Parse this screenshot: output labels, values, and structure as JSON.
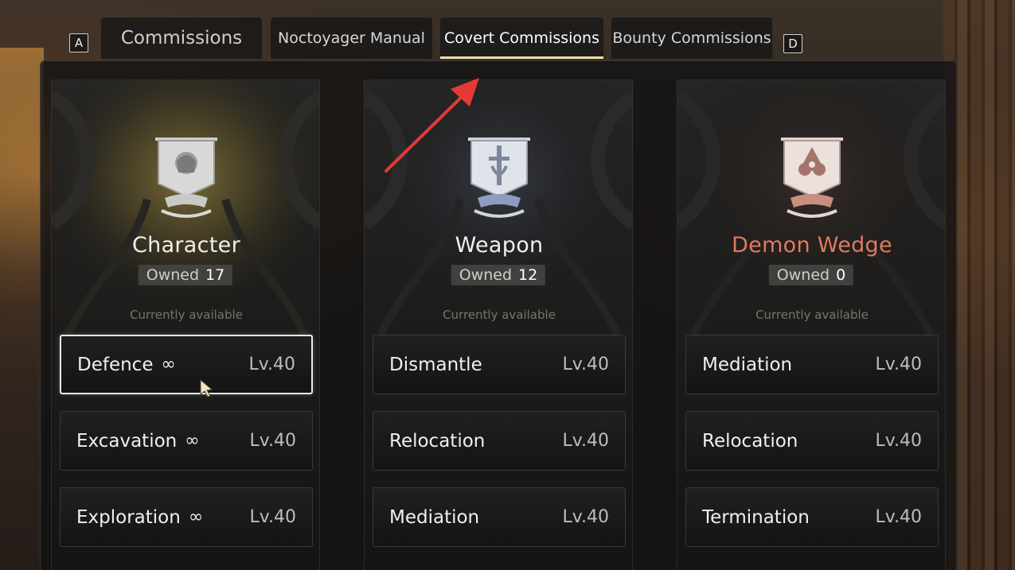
{
  "tabs": {
    "key_left": "A",
    "key_right": "D",
    "commissions": "Commissions",
    "manual": "Noctoyager Manual",
    "covert": "Covert Commissions",
    "bounty": "Bounty Commissions",
    "active": "Covert Commissions"
  },
  "cards": [
    {
      "title": "Character",
      "owned_label": "Owned",
      "owned_count": "17",
      "availability": "Currently available",
      "emblem": "character-emblem-icon",
      "accent": "#e8e6e1",
      "missions": [
        {
          "name": "Defence",
          "infinite": "∞",
          "level": "Lv.40",
          "selected": true
        },
        {
          "name": "Excavation",
          "infinite": "∞",
          "level": "Lv.40"
        },
        {
          "name": "Exploration",
          "infinite": "∞",
          "level": "Lv.40"
        }
      ]
    },
    {
      "title": "Weapon",
      "owned_label": "Owned",
      "owned_count": "12",
      "availability": "Currently available",
      "emblem": "weapon-emblem-icon",
      "accent": "#e8e6e1",
      "missions": [
        {
          "name": "Dismantle",
          "level": "Lv.40"
        },
        {
          "name": "Relocation",
          "level": "Lv.40"
        },
        {
          "name": "Mediation",
          "level": "Lv.40"
        }
      ]
    },
    {
      "title": "Demon Wedge",
      "owned_label": "Owned",
      "owned_count": "0",
      "availability": "Currently available",
      "emblem": "demon-wedge-emblem-icon",
      "accent": "#e07a5f",
      "missions": [
        {
          "name": "Mediation",
          "level": "Lv.40"
        },
        {
          "name": "Relocation",
          "level": "Lv.40"
        },
        {
          "name": "Termination",
          "level": "Lv.40"
        }
      ]
    }
  ],
  "colors": {
    "tab_underline": "#f0dca8",
    "demon_wedge_title": "#e07a5f",
    "annotation_arrow": "#e53935"
  }
}
